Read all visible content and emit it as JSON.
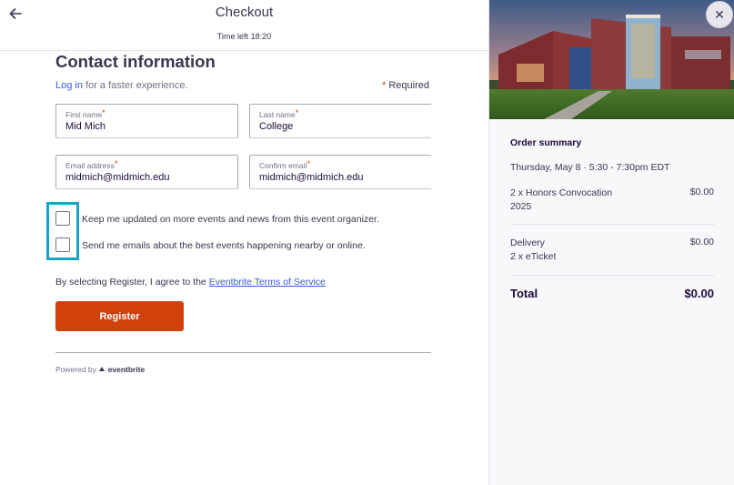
{
  "header": {
    "title": "Checkout",
    "time_left": "Time left 18:20"
  },
  "contact": {
    "heading": "Contact information",
    "login_link": "Log in",
    "login_suffix": " for a faster experience.",
    "required_star": "*",
    "required_label": " Required"
  },
  "fields": {
    "first_name": {
      "label": "First name",
      "value": "Mid Mich"
    },
    "last_name": {
      "label": "Last name",
      "value": "College"
    },
    "email": {
      "label": "Email address",
      "value": "midmich@midmich.edu"
    },
    "confirm_email": {
      "label": "Confirm email",
      "value": "midmich@midmich.edu"
    },
    "required_mark": "*"
  },
  "checkboxes": [
    {
      "label": "Keep me updated on more events and news from this event organizer.",
      "checked": false
    },
    {
      "label": "Send me emails about the best events happening nearby or online.",
      "checked": false
    }
  ],
  "terms": {
    "prefix": "By selecting Register, I agree to the ",
    "link": "Eventbrite Terms of Service"
  },
  "register_label": "Register",
  "powered": {
    "prefix": "Powered by",
    "brand": "eventbrite"
  },
  "summary": {
    "title": "Order summary",
    "date": "Thursday, May 8 · 5:30 - 7:30pm EDT",
    "items": [
      {
        "line1": "2 x Honors Convocation",
        "line2": "2025",
        "price": "$0.00"
      },
      {
        "line1": "Delivery",
        "line2": "2 x eTicket",
        "price": "$0.00"
      }
    ],
    "total_label": "Total",
    "total_value": "$0.00"
  },
  "icons": {
    "back": "arrow-left-icon",
    "close": "close-icon",
    "brand_logo": "eventbrite-logo-icon"
  },
  "colors": {
    "accent": "#d1410c",
    "link": "#3659e3",
    "highlight": "#1aa3c9"
  }
}
